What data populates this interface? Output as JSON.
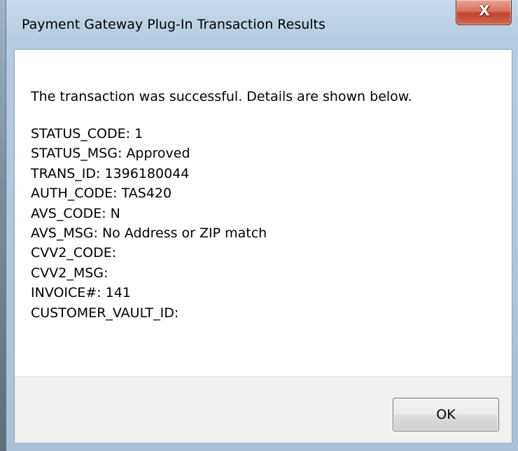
{
  "window": {
    "title": "Payment Gateway Plug-In Transaction Results",
    "close_glyph": "X"
  },
  "content": {
    "message": "The transaction was successful.  Details are shown below.",
    "details": [
      "STATUS_CODE: 1",
      "STATUS_MSG: Approved",
      "TRANS_ID: 1396180044",
      "AUTH_CODE: TAS420",
      "AVS_CODE: N",
      "AVS_MSG: No Address or ZIP match",
      "CVV2_CODE:",
      "CVV2_MSG:",
      "INVOICE#: 141",
      "CUSTOMER_VAULT_ID:"
    ]
  },
  "buttons": {
    "ok_label": "OK"
  },
  "icons": {
    "close": "close-icon"
  },
  "colors": {
    "close_button": "#c7452e",
    "dialog_background": "#ffffff",
    "button_area": "#f0f0f0"
  }
}
